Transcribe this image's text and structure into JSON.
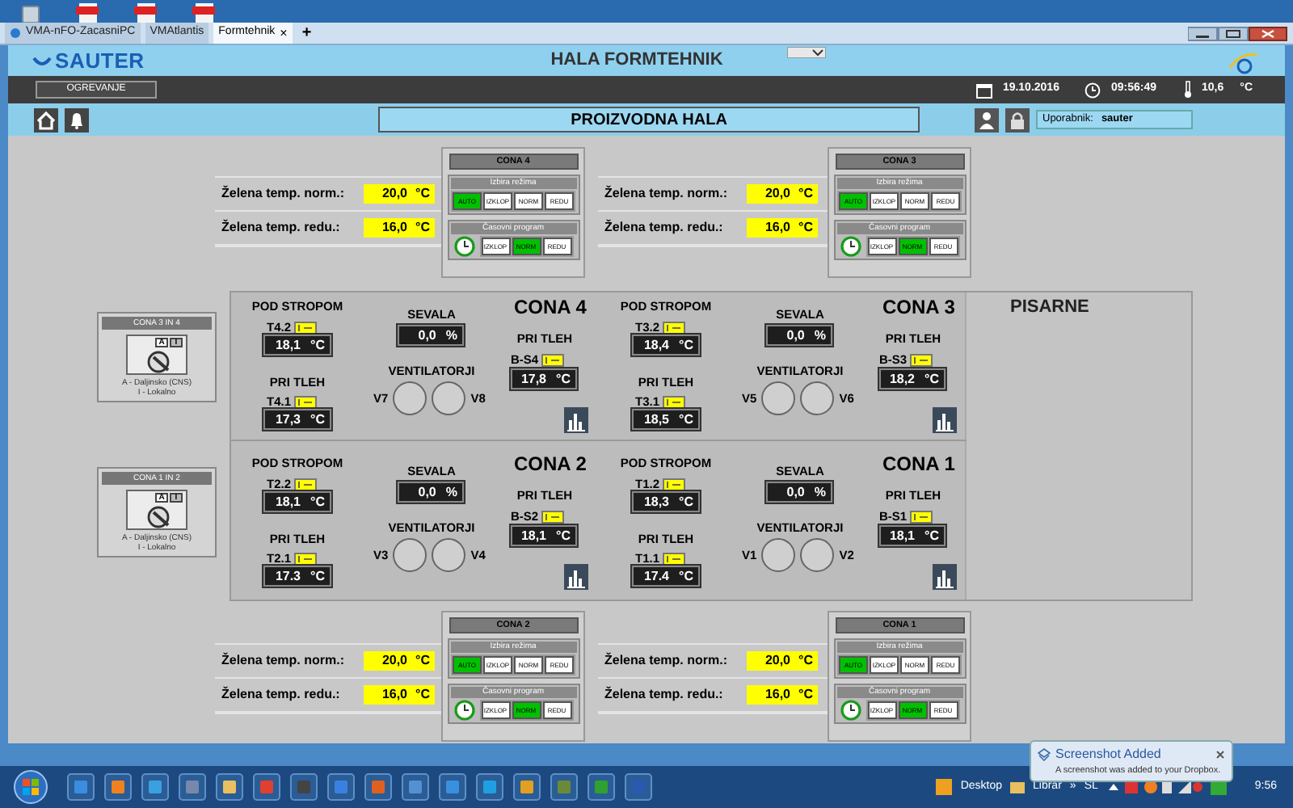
{
  "browser": {
    "tabs": [
      {
        "label": "VMA-nFO-ZacasniPC",
        "selected": false
      },
      {
        "label": "VMAtlantis",
        "selected": false
      },
      {
        "label": "Formtehnik",
        "selected": true
      }
    ],
    "new_tab": "+",
    "close": "×"
  },
  "header": {
    "logo": "SAUTER",
    "title": "HALA FORMTEHNIK"
  },
  "status_bar": {
    "section_button": "OGREVANJE",
    "date": "19.10.2016",
    "time": "09:56:49",
    "outdoor_temp": "10,6",
    "temp_unit": "°C"
  },
  "nav": {
    "page_title": "PROIZVODNA HALA",
    "user_label": "Uporabnik:",
    "user": "sauter"
  },
  "setpoint_panels": [
    {
      "rows": [
        {
          "label": "Želena temp. norm.:",
          "value": "20,0",
          "unit": "°C"
        },
        {
          "label": "Želena temp. redu.:",
          "value": "16,0",
          "unit": "°C"
        }
      ]
    },
    {
      "rows": [
        {
          "label": "Želena temp. norm.:",
          "value": "20,0",
          "unit": "°C"
        },
        {
          "label": "Želena temp. redu.:",
          "value": "16,0",
          "unit": "°C"
        }
      ]
    },
    {
      "rows": [
        {
          "label": "Želena temp. norm.:",
          "value": "20,0",
          "unit": "°C"
        },
        {
          "label": "Želena temp. redu.:",
          "value": "16,0",
          "unit": "°C"
        }
      ]
    },
    {
      "rows": [
        {
          "label": "Želena temp. norm.:",
          "value": "20,0",
          "unit": "°C"
        },
        {
          "label": "Želena temp. redu.:",
          "value": "16,0",
          "unit": "°C"
        }
      ]
    }
  ],
  "mode_panels": [
    {
      "title": "CONA 4",
      "mode_title": "Izbira režima",
      "modes": [
        {
          "label": "AUTO",
          "selected": true
        },
        {
          "label": "IZKLOP",
          "selected": false
        },
        {
          "label": "NORM",
          "selected": false
        },
        {
          "label": "REDU",
          "selected": false
        }
      ],
      "schedule_title": "Časovni program",
      "schedule": [
        {
          "label": "IZKLOP",
          "selected": false
        },
        {
          "label": "NORM",
          "selected": true
        },
        {
          "label": "REDU",
          "selected": false
        }
      ]
    },
    {
      "title": "CONA 3",
      "mode_title": "Izbira režima",
      "modes": [
        {
          "label": "AUTO",
          "selected": true
        },
        {
          "label": "IZKLOP",
          "selected": false
        },
        {
          "label": "NORM",
          "selected": false
        },
        {
          "label": "REDU",
          "selected": false
        }
      ],
      "schedule_title": "Časovni program",
      "schedule": [
        {
          "label": "IZKLOP",
          "selected": false
        },
        {
          "label": "NORM",
          "selected": true
        },
        {
          "label": "REDU",
          "selected": false
        }
      ]
    },
    {
      "title": "CONA 2",
      "mode_title": "Izbira režima",
      "modes": [
        {
          "label": "AUTO",
          "selected": true
        },
        {
          "label": "IZKLOP",
          "selected": false
        },
        {
          "label": "NORM",
          "selected": false
        },
        {
          "label": "REDU",
          "selected": false
        }
      ],
      "schedule_title": "Časovni program",
      "schedule": [
        {
          "label": "IZKLOP",
          "selected": false
        },
        {
          "label": "NORM",
          "selected": true
        },
        {
          "label": "REDU",
          "selected": false
        }
      ]
    },
    {
      "title": "CONA 1",
      "mode_title": "Izbira režima",
      "modes": [
        {
          "label": "AUTO",
          "selected": true
        },
        {
          "label": "IZKLOP",
          "selected": false
        },
        {
          "label": "NORM",
          "selected": false
        },
        {
          "label": "REDU",
          "selected": false
        }
      ],
      "schedule_title": "Časovni program",
      "schedule": [
        {
          "label": "IZKLOP",
          "selected": false
        },
        {
          "label": "NORM",
          "selected": true
        },
        {
          "label": "REDU",
          "selected": false
        }
      ]
    }
  ],
  "switches": [
    {
      "title": "CONA 3 IN 4",
      "positions": [
        {
          "label": "A",
          "selected": true
        },
        {
          "label": "I",
          "selected": false
        }
      ],
      "legend": [
        "A - Daljinsko (CNS)",
        "I - Lokalno"
      ]
    },
    {
      "title": "CONA 1 IN 2",
      "positions": [
        {
          "label": "A",
          "selected": true
        },
        {
          "label": "I",
          "selected": false
        }
      ],
      "legend": [
        "A - Daljinsko (CNS)",
        "I - Lokalno"
      ]
    }
  ],
  "zones": [
    {
      "title": "CONA 4",
      "ceiling": {
        "label": "POD STROPOM",
        "sensor": "T4.2",
        "value": "18,1",
        "unit": "°C"
      },
      "floor": {
        "label": "PRI TLEH",
        "sensor": "T4.1",
        "value": "17,3",
        "unit": "°C"
      },
      "radiation": {
        "label": "SEVALA",
        "value": "0,0",
        "unit": "%"
      },
      "fans": {
        "label": "VENTILATORJI",
        "left": "V7",
        "right": "V8"
      },
      "slab": {
        "label": "PRI TLEH",
        "sensor": "B-S4",
        "value": "17,8",
        "unit": "°C"
      }
    },
    {
      "title": "CONA 3",
      "ceiling": {
        "label": "POD STROPOM",
        "sensor": "T3.2",
        "value": "18,4",
        "unit": "°C"
      },
      "floor": {
        "label": "PRI TLEH",
        "sensor": "T3.1",
        "value": "18,5",
        "unit": "°C"
      },
      "radiation": {
        "label": "SEVALA",
        "value": "0,0",
        "unit": "%"
      },
      "fans": {
        "label": "VENTILATORJI",
        "left": "V5",
        "right": "V6"
      },
      "slab": {
        "label": "PRI TLEH",
        "sensor": "B-S3",
        "value": "18,2",
        "unit": "°C"
      }
    },
    {
      "title": "CONA 2",
      "ceiling": {
        "label": "POD STROPOM",
        "sensor": "T2.2",
        "value": "18,1",
        "unit": "°C"
      },
      "floor": {
        "label": "PRI TLEH",
        "sensor": "T2.1",
        "value": "17.3",
        "unit": "°C"
      },
      "radiation": {
        "label": "SEVALA",
        "value": "0,0",
        "unit": "%"
      },
      "fans": {
        "label": "VENTILATORJI",
        "left": "V3",
        "right": "V4"
      },
      "slab": {
        "label": "PRI TLEH",
        "sensor": "B-S2",
        "value": "18,1",
        "unit": "°C"
      }
    },
    {
      "title": "CONA 1",
      "ceiling": {
        "label": "POD STROPOM",
        "sensor": "T1.2",
        "value": "18,3",
        "unit": "°C"
      },
      "floor": {
        "label": "PRI TLEH",
        "sensor": "T1.1",
        "value": "17.4",
        "unit": "°C"
      },
      "radiation": {
        "label": "SEVALA",
        "value": "0,0",
        "unit": "%"
      },
      "fans": {
        "label": "VENTILATORJI",
        "left": "V1",
        "right": "V2"
      },
      "slab": {
        "label": "PRI TLEH",
        "sensor": "B-S1",
        "value": "18,1",
        "unit": "°C"
      }
    }
  ],
  "area_label": "PISARNE",
  "taskbar": {
    "tray_items": [
      "Desktop",
      "Librar",
      "»",
      "SL"
    ],
    "clock": "9:56"
  },
  "notification": {
    "title": "Screenshot Added",
    "text": "A screenshot was added to your Dropbox."
  }
}
